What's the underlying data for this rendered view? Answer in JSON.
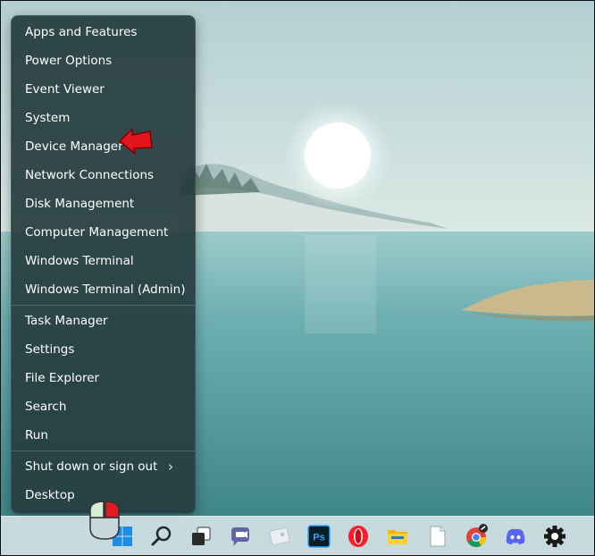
{
  "context_menu": {
    "items": [
      {
        "label": "Apps and Features"
      },
      {
        "label": "Power Options"
      },
      {
        "label": "Event Viewer"
      },
      {
        "label": "System"
      },
      {
        "label": "Device Manager"
      },
      {
        "label": "Network Connections"
      },
      {
        "label": "Disk Management"
      },
      {
        "label": "Computer Management"
      },
      {
        "label": "Windows Terminal"
      },
      {
        "label": "Windows Terminal (Admin)"
      },
      {
        "label": "Task Manager"
      },
      {
        "label": "Settings"
      },
      {
        "label": "File Explorer"
      },
      {
        "label": "Search"
      },
      {
        "label": "Run"
      },
      {
        "label": "Shut down or sign out"
      },
      {
        "label": "Desktop"
      }
    ],
    "submenu_indicator": "›",
    "highlighted_item": "Device Manager",
    "annotation_color": "#e4141b"
  },
  "taskbar": {
    "icons": [
      {
        "name": "windows-start-icon"
      },
      {
        "name": "search-icon"
      },
      {
        "name": "task-view-icon"
      },
      {
        "name": "teams-chat-icon"
      },
      {
        "name": "widgets-icon"
      },
      {
        "name": "photoshop-icon",
        "text": "Ps"
      },
      {
        "name": "opera-icon"
      },
      {
        "name": "file-explorer-icon"
      },
      {
        "name": "notepad-icon"
      },
      {
        "name": "chrome-icon"
      },
      {
        "name": "discord-icon"
      },
      {
        "name": "settings-gear-icon"
      }
    ]
  }
}
